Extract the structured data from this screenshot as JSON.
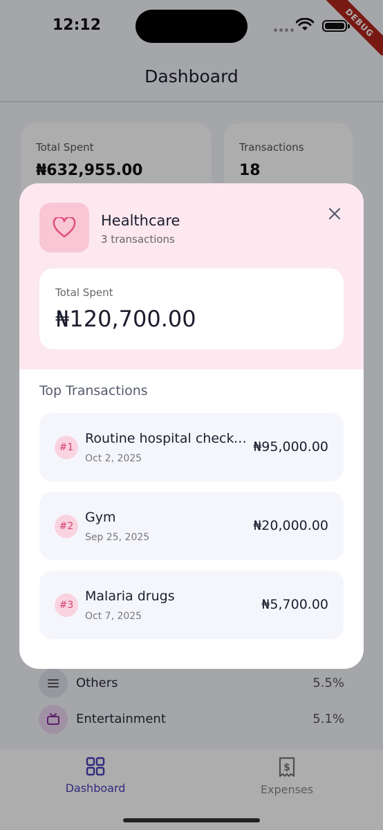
{
  "status_bar": {
    "time": "12:12",
    "debug_label": "DEBUG"
  },
  "header": {
    "title": "Dashboard"
  },
  "stats": {
    "total_spent_label": "Total Spent",
    "total_spent_value": "₦632,955.00",
    "transactions_label": "Transactions",
    "transactions_value": "18"
  },
  "categories": [
    {
      "name": "Others",
      "percent": "5.5%",
      "icon": "list-icon",
      "color": "#dfe1ea"
    },
    {
      "name": "Entertainment",
      "percent": "5.1%",
      "icon": "tv-icon",
      "color": "#ecd7f2"
    }
  ],
  "modal": {
    "category": "Healthcare",
    "subtitle": "3 transactions",
    "icon": "heart-icon",
    "accent_color": "#e0507e",
    "total_label": "Total Spent",
    "total_value": "₦120,700.00",
    "section_title": "Top Transactions",
    "transactions": [
      {
        "rank": "#1",
        "name": "Routine hospital checkup",
        "date": "Oct 2, 2025",
        "amount": "₦95,000.00"
      },
      {
        "rank": "#2",
        "name": "Gym",
        "date": "Sep 25, 2025",
        "amount": "₦20,000.00"
      },
      {
        "rank": "#3",
        "name": "Malaria drugs",
        "date": "Oct 7, 2025",
        "amount": "₦5,700.00"
      }
    ]
  },
  "bottom_nav": {
    "items": [
      {
        "label": "Dashboard",
        "icon": "grid-icon",
        "active": true
      },
      {
        "label": "Expenses",
        "icon": "receipt-icon",
        "active": false
      }
    ]
  }
}
